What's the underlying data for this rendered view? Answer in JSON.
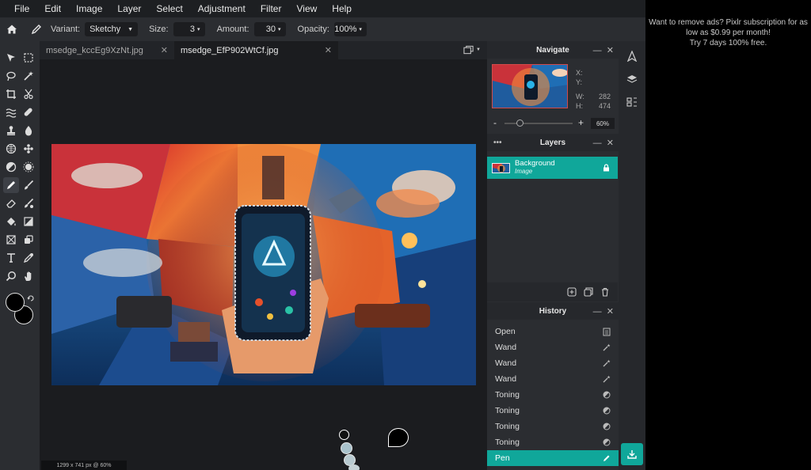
{
  "menu": [
    "File",
    "Edit",
    "Image",
    "Layer",
    "Select",
    "Adjustment",
    "Filter",
    "View",
    "Help"
  ],
  "options": {
    "variant_label": "Variant:",
    "variant_value": "Sketchy",
    "size_label": "Size:",
    "size_value": "3",
    "amount_label": "Amount:",
    "amount_value": "30",
    "opacity_label": "Opacity:",
    "opacity_value": "100%"
  },
  "tabs": [
    {
      "name": "msedge_kccEg9XzNt.jpg",
      "active": false
    },
    {
      "name": "msedge_EfP902WtCf.jpg",
      "active": true
    }
  ],
  "status": "1299 x 741 px @ 60%",
  "navigate": {
    "title": "Navigate",
    "x_label": "X:",
    "y_label": "Y:",
    "w_label": "W:",
    "h_label": "H:",
    "w_value": "282",
    "h_value": "474",
    "zoom": "60%",
    "zoom_fraction": 0.22
  },
  "layers": {
    "title": "Layers",
    "items": [
      {
        "name": "Background",
        "type": "Image"
      }
    ]
  },
  "history": {
    "title": "History",
    "items": [
      {
        "label": "Open",
        "icon": "document-icon"
      },
      {
        "label": "Wand",
        "icon": "magic-wand-icon"
      },
      {
        "label": "Wand",
        "icon": "magic-wand-icon"
      },
      {
        "label": "Wand",
        "icon": "magic-wand-icon"
      },
      {
        "label": "Toning",
        "icon": "toning-icon"
      },
      {
        "label": "Toning",
        "icon": "toning-icon"
      },
      {
        "label": "Toning",
        "icon": "toning-icon"
      },
      {
        "label": "Toning",
        "icon": "toning-icon"
      },
      {
        "label": "Pen",
        "icon": "pen-icon",
        "active": true
      }
    ]
  },
  "ad": {
    "line1": "Want to remove ads? Pixlr subscription for as",
    "line2": "low as $0.99 per month!",
    "line3": "Try 7 days 100% free."
  },
  "colors": {
    "accent": "#10a79a",
    "foreground": "#000000",
    "background": "#000000"
  }
}
